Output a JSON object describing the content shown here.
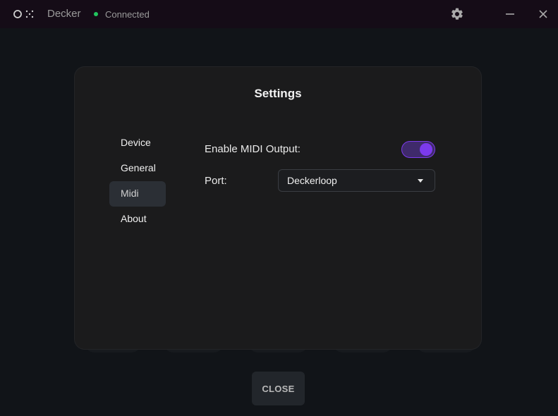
{
  "titlebar": {
    "app_name": "Decker",
    "status": "Connected",
    "logo_icon": "ox-logo-icon",
    "settings_icon": "gear-icon",
    "minimize_icon": "minimize-icon",
    "close_icon": "close-icon",
    "status_color": "#22c55e"
  },
  "modal": {
    "title": "Settings",
    "nav": [
      {
        "label": "Device"
      },
      {
        "label": "General"
      },
      {
        "label": "Midi"
      },
      {
        "label": "About"
      }
    ],
    "active_nav": "Midi",
    "midi": {
      "enable_label": "Enable MIDI Output:",
      "enable_value": true,
      "port_label": "Port:",
      "port_value": "Deckerloop"
    },
    "accent_color": "#7c3aed"
  },
  "footer": {
    "close_label": "CLOSE"
  }
}
